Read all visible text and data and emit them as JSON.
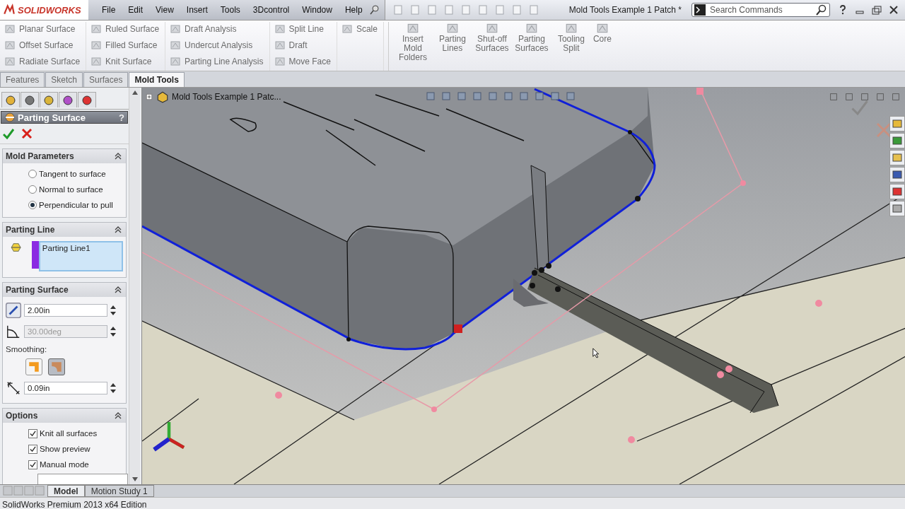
{
  "title_bar": {
    "logo": "SOLIDWORKS",
    "menu": [
      "File",
      "Edit",
      "View",
      "Insert",
      "Tools",
      "3Dcontrol",
      "Window",
      "Help"
    ],
    "document_title": "Mold Tools Example 1 Patch *",
    "search": {
      "placeholder": "Search Commands"
    }
  },
  "ribbon": {
    "columns": [
      [
        "Planar Surface",
        "Offset Surface",
        "Radiate Surface"
      ],
      [
        "Ruled Surface",
        "Filled Surface",
        "Knit Surface"
      ],
      [
        "Draft Analysis",
        "Undercut Analysis",
        "Parting Line Analysis"
      ],
      [
        "Split Line",
        "Draft",
        "Move Face"
      ],
      [
        "Scale"
      ]
    ],
    "large_buttons": [
      "Insert Mold Folders",
      "Parting Lines",
      "Shut-off Surfaces",
      "Parting Surfaces",
      "Tooling Split",
      "Core"
    ]
  },
  "command_tabs": [
    {
      "label": "Features",
      "selected": false
    },
    {
      "label": "Sketch",
      "selected": false
    },
    {
      "label": "Surfaces",
      "selected": false
    },
    {
      "label": "Mold Tools",
      "selected": true
    }
  ],
  "feature_tree": {
    "item": "Mold Tools Example 1 Patc..."
  },
  "property_manager": {
    "title": "Parting Surface",
    "help": "?",
    "sections": [
      {
        "kind": "radios",
        "title": "Mold Parameters",
        "options": [
          {
            "label": "Tangent to surface",
            "selected": false
          },
          {
            "label": "Normal to surface",
            "selected": false
          },
          {
            "label": "Perpendicular to pull",
            "selected": true
          }
        ]
      },
      {
        "kind": "selection",
        "title": "Parting Line",
        "items": [
          "Parting Line1"
        ]
      },
      {
        "kind": "parameters",
        "title": "Parting Surface",
        "distance": "2.00in",
        "angle": {
          "value": "30.00deg",
          "disabled": true
        },
        "smoothing_label": "Smoothing:",
        "smoothing": [
          {
            "selected": false
          },
          {
            "selected": true
          }
        ],
        "smoothing_distance": "0.09in"
      },
      {
        "kind": "checkboxes",
        "title": "Options",
        "options": [
          {
            "label": "Knit all surfaces",
            "checked": true
          },
          {
            "label": "Show preview",
            "checked": true
          },
          {
            "label": "Manual mode",
            "checked": true
          }
        ]
      }
    ]
  },
  "bottom_tabs": [
    {
      "label": "Model",
      "selected": true
    },
    {
      "label": "Motion Study 1",
      "selected": false
    }
  ],
  "status_bar": {
    "text": "SolidWorks Premium 2013 x64 Edition"
  }
}
